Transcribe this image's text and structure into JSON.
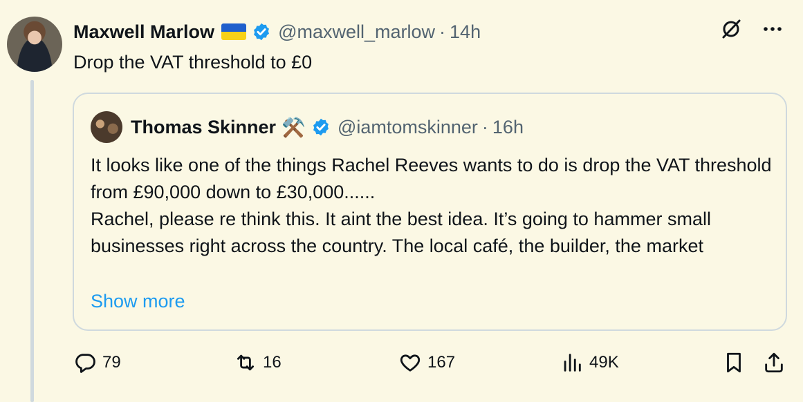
{
  "tweet": {
    "author_name": "Maxwell Marlow",
    "handle": "@maxwell_marlow",
    "separator": "·",
    "time": "14h",
    "text": "Drop the VAT threshold to £0"
  },
  "quote": {
    "author_name": "Thomas Skinner",
    "emoji": "⚒️",
    "handle": "@iamtomskinner",
    "separator": "·",
    "time": "16h",
    "text": "It looks like one of the things Rachel Reeves wants to do is drop the VAT threshold from £90,000 down to £30,000......\nRachel, please re think this. It aint the best idea. It’s going to hammer small businesses right across the country. The local café, the builder, the market",
    "show_more": "Show more"
  },
  "actions": {
    "replies": "79",
    "reposts": "16",
    "likes": "167",
    "views": "49K"
  },
  "colors": {
    "background": "#fbf8e4",
    "verified": "#1d9bf0",
    "link": "#1d9bf0",
    "secondary_text": "#536471",
    "border": "#cfd9de"
  },
  "icons": {
    "verified": "verified-badge-icon",
    "grok": "grok-icon",
    "more": "more-icon",
    "reply": "reply-icon",
    "repost": "repost-icon",
    "like": "like-icon",
    "views": "views-icon",
    "bookmark": "bookmark-icon",
    "share": "share-icon"
  }
}
